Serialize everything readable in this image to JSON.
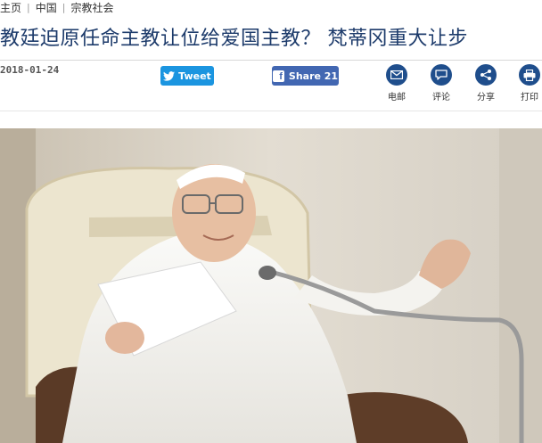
{
  "breadcrumb": {
    "items": [
      "主页",
      "中国",
      "宗教社会"
    ],
    "separator": "|"
  },
  "article": {
    "headline": "教廷迫原任命主教让位给爱国主教？ 梵蒂冈重大让步",
    "date": "2018-01-24"
  },
  "social": {
    "tweet_label": "Tweet",
    "share_label": "Share 21",
    "fb_glyph": "f"
  },
  "tools": [
    {
      "label": "电邮",
      "icon": "mail-icon"
    },
    {
      "label": "评论",
      "icon": "comment-icon"
    },
    {
      "label": "分享",
      "icon": "share-icon"
    },
    {
      "label": "打印",
      "icon": "print-icon"
    }
  ],
  "colors": {
    "headline": "#1d3b6b",
    "tool_circle": "#1f4e8c",
    "tweet": "#1b95e0",
    "facebook": "#4267b2"
  }
}
